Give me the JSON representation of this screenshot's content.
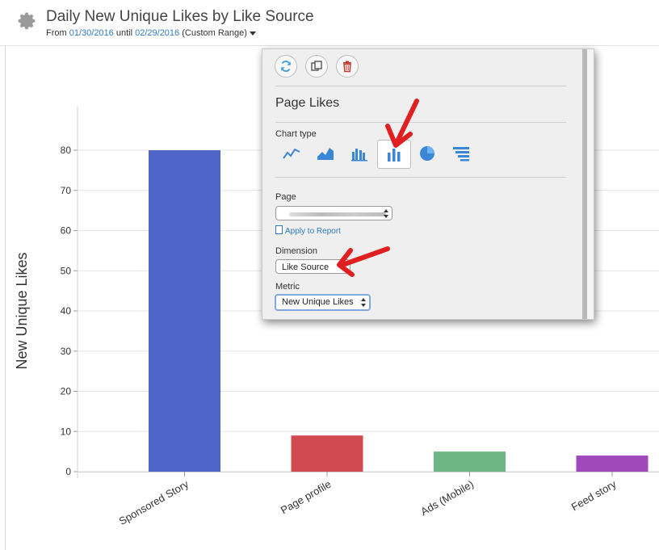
{
  "header": {
    "title": "Daily New Unique Likes by Like Source",
    "from_label": "From",
    "from_date": "01/30/2016",
    "until_label": "until",
    "until_date": "02/29/2016",
    "range_label": "(Custom Range)"
  },
  "panel": {
    "title": "Page Likes",
    "chart_type_label": "Chart type",
    "chart_types": [
      "line-chart",
      "area-chart",
      "column-chart",
      "bar-chart",
      "pie-chart",
      "funnel-chart"
    ],
    "selected_chart_type": "bar-chart",
    "page_label": "Page",
    "page_value": "",
    "apply_label": "Apply to Report",
    "dimension_label": "Dimension",
    "dimension_value": "Like Source",
    "metric_label": "Metric",
    "metric_value": "New Unique Likes",
    "buttons": [
      "refresh-icon",
      "copy-icon",
      "trash-icon"
    ]
  },
  "colors": {
    "link": "#2f7bbf",
    "annotation_arrow": "#e02020",
    "trash": "#c0392b",
    "refresh": "#4a9fe0",
    "chart_icon": "#3a87d8"
  },
  "chart_data": {
    "type": "bar",
    "ylabel": "New Unique Likes",
    "xlabel": "",
    "categories": [
      "Sponsored Story",
      "Page profile",
      "Ads (Mobile)",
      "Feed story"
    ],
    "values": [
      80,
      9,
      5,
      4
    ],
    "colors": [
      "#5065c8",
      "#d14a50",
      "#6db784",
      "#a049bd"
    ],
    "ylim": [
      0,
      80
    ],
    "yticks": [
      0,
      10,
      20,
      30,
      40,
      50,
      60,
      70,
      80
    ],
    "grid": true
  }
}
